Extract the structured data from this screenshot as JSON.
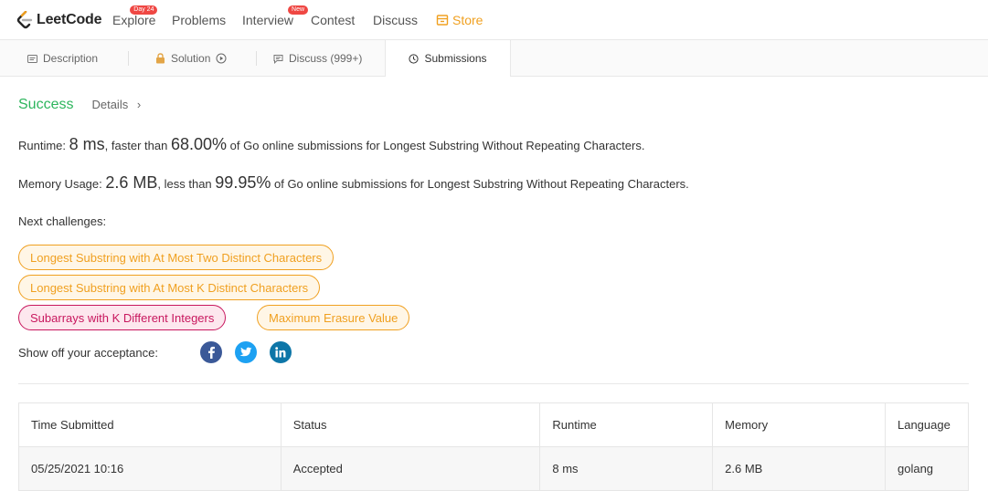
{
  "topnav": {
    "logo_text": "LeetCode",
    "items": [
      {
        "label": "Explore",
        "badge": "Day 24"
      },
      {
        "label": "Problems"
      },
      {
        "label": "Interview",
        "badge": "New"
      },
      {
        "label": "Contest"
      },
      {
        "label": "Discuss"
      },
      {
        "label": "Store"
      }
    ],
    "colors": {
      "badge": "#ef4743",
      "store": "#f0a020"
    }
  },
  "tabs": [
    {
      "label": "Description",
      "icon": "description-icon"
    },
    {
      "label": "Solution",
      "icon": "lock-icon",
      "suffix_icon": "play-icon"
    },
    {
      "label": "Discuss (999+)",
      "icon": "chat-icon"
    },
    {
      "label": "Submissions",
      "icon": "clock-icon",
      "active": true
    }
  ],
  "result": {
    "status": "Success",
    "details": "Details",
    "runtime": {
      "label": "Runtime:",
      "value": "8 ms",
      "mid": ", faster than",
      "percent": "68.00%",
      "tail": "of Go online submissions for Longest Substring Without Repeating Characters."
    },
    "memory": {
      "label": "Memory Usage:",
      "value": "2.6 MB",
      "mid": ", less than",
      "percent": "99.95%",
      "tail": "of Go online submissions for Longest Substring Without Repeating Characters."
    },
    "colors": {
      "success": "#2db55d"
    }
  },
  "next_challenges": {
    "label": "Next challenges:",
    "items": [
      {
        "title": "Longest Substring with At Most Two Distinct Characters",
        "difficulty": "medium"
      },
      {
        "title": "Longest Substring with At Most K Distinct Characters",
        "difficulty": "medium"
      },
      {
        "title": "Subarrays with K Different Integers",
        "difficulty": "hard"
      },
      {
        "title": "Maximum Erasure Value",
        "difficulty": "medium"
      }
    ],
    "colors": {
      "medium": "#f0a020",
      "hard": "#c8175e"
    }
  },
  "share": {
    "label": "Show off your acceptance:",
    "icons": [
      "facebook-icon",
      "twitter-icon",
      "linkedin-icon"
    ],
    "colors": {
      "facebook": "#3b5998",
      "twitter": "#1da1f2",
      "linkedin": "#0e76a8"
    }
  },
  "submissions": {
    "headers": [
      "Time Submitted",
      "Status",
      "Runtime",
      "Memory",
      "Language"
    ],
    "rows": [
      [
        "05/25/2021 10:16",
        "Accepted",
        "8 ms",
        "2.6 MB",
        "golang"
      ]
    ]
  }
}
